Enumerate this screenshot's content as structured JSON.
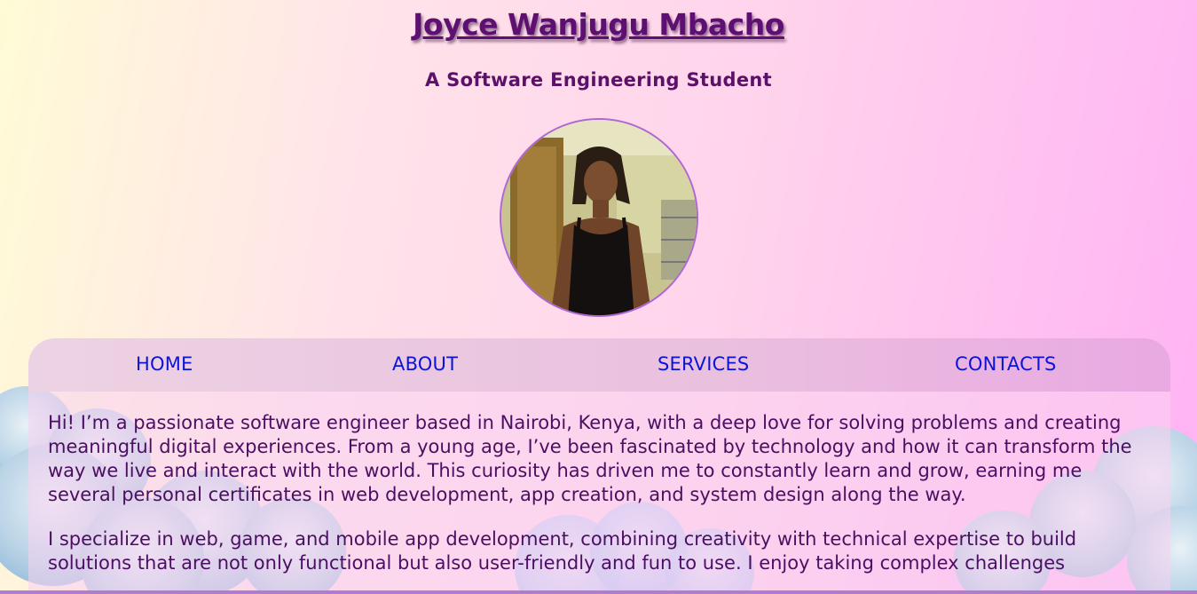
{
  "header": {
    "name": "Joyce Wanjugu Mbacho",
    "subtitle": "A Software Engineering Student",
    "avatar_alt": "profile photo"
  },
  "nav": {
    "items": [
      {
        "label": "HOME"
      },
      {
        "label": "ABOUT"
      },
      {
        "label": "SERVICES"
      },
      {
        "label": "CONTACTS"
      }
    ]
  },
  "about": {
    "paragraphs": [
      "Hi! I’m a passionate software engineer based in Nairobi, Kenya, with a deep love for solving problems and creating meaningful digital experiences. From a young age, I’ve been fascinated by technology and how it can transform the way we live and interact with the world. This curiosity has driven me to constantly learn and grow, earning me several personal certificates in web development, app creation, and system design along the way.",
      "I specialize in web, game, and mobile app development, combining creativity with technical expertise to build solutions that are not only functional but also user-friendly and fun to use. I enjoy taking complex challenges"
    ]
  },
  "colors": {
    "link": "#0b14d8",
    "heading": "#5e0f72",
    "text": "#4b0e62",
    "avatar_border": "#b066d6"
  }
}
